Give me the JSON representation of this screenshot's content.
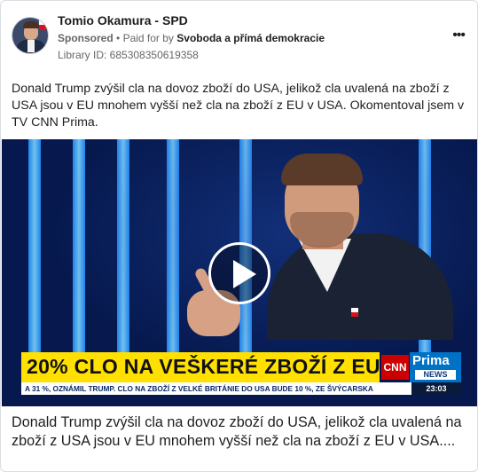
{
  "ad": {
    "page_name": "Tomio Okamura - SPD",
    "sponsored_label": "Sponsored",
    "paid_for_prefix": "Paid for by",
    "payer": "Svoboda a přímá demokracie",
    "library_id": "Library ID: 685308350619358",
    "more_label": "•••",
    "avatar_icon": "profile-photo-icon",
    "body_text": "Donald Trump zvýšil cla na dovoz zboží do USA, jelikož cla uvalená na zboží z USA jsou v EU mnohem vyšší než cla na zboží z EU v USA. Okomentoval jsem v TV CNN Prima.",
    "caption": "Donald Trump zvýšil cla na dovoz zboží do USA, jelikož cla uvalená na zboží z USA jsou v EU mnohem vyšší než cla na zboží z EU v USA...."
  },
  "video": {
    "play_icon": "play-icon",
    "headline": "20% CLO NA VEŠKERÉ ZBOŽÍ Z EU",
    "ticker": "A 31 %, OZNÁMIL TRUMP.      CLO NA ZBOŽÍ Z VELKÉ BRITÁNIE DO USA BUDE 10 %, ZE ŠVÝCARSKA",
    "channel_logo": "CNN",
    "prima_logo": "Prima",
    "news_label": "NEWS",
    "clock": "23:03"
  },
  "colors": {
    "lower_third": "#ffe000",
    "studio_bg": "#06184d",
    "prima_blue": "#0072c6",
    "cnn_red": "#cc0000"
  }
}
